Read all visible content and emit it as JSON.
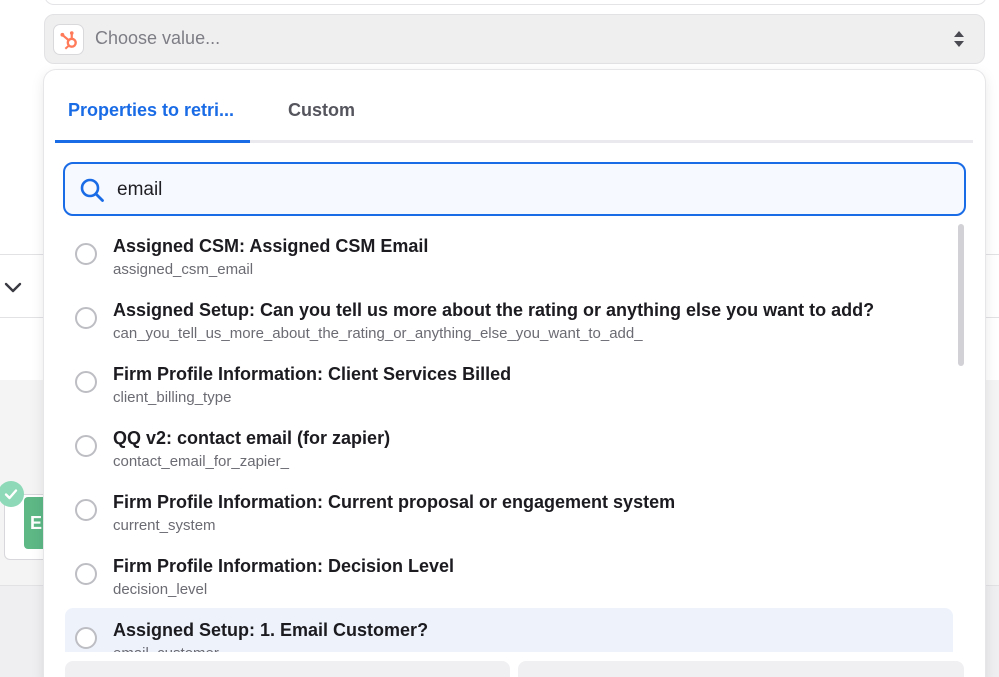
{
  "select": {
    "placeholder": "Choose value...",
    "app_icon": "hubspot-icon",
    "arrows_icon": "select-arrows-icon"
  },
  "tabs": [
    {
      "label": "Properties to retri...",
      "active": true
    },
    {
      "label": "Custom",
      "active": false
    }
  ],
  "search": {
    "value": "email",
    "icon": "search-icon"
  },
  "options": [
    {
      "label": "Assigned CSM: Assigned CSM Email",
      "key": "assigned_csm_email"
    },
    {
      "label": "Assigned Setup: Can you tell us more about the rating or anything else you want to add?",
      "key": "can_you_tell_us_more_about_the_rating_or_anything_else_you_want_to_add_"
    },
    {
      "label": "Firm Profile Information: Client Services Billed",
      "key": "client_billing_type"
    },
    {
      "label": "QQ v2: contact email (for zapier)",
      "key": "contact_email_for_zapier_"
    },
    {
      "label": "Firm Profile Information: Current proposal or engagement system",
      "key": "current_system"
    },
    {
      "label": "Firm Profile Information: Decision Level",
      "key": "decision_level"
    },
    {
      "label": "Assigned Setup: 1. Email Customer?",
      "key": "email_customer"
    }
  ],
  "colors": {
    "accent": "#1a6be6",
    "hubspot": "#ff7a59",
    "success": "#8ed9b7",
    "sheets": "#5db886"
  }
}
